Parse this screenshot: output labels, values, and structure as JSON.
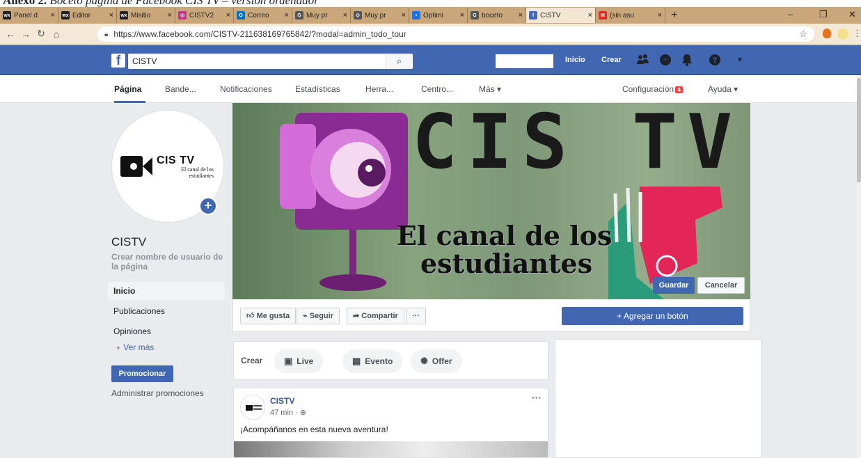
{
  "document": {
    "caption_prefix": "Anexo 2.",
    "caption_text": "Boceto página de Facebook CIS TV – versión ordenador"
  },
  "browser": {
    "tabs": [
      {
        "label": "Panel d",
        "fav": "wx",
        "color": "#222"
      },
      {
        "label": "Editor",
        "fav": "wx",
        "color": "#222"
      },
      {
        "label": "Misitio",
        "fav": "wx",
        "color": "#222"
      },
      {
        "label": "CISTV2",
        "fav": "◎",
        "color": "#c13584"
      },
      {
        "label": "Correo",
        "fav": "O",
        "color": "#0072c6"
      },
      {
        "label": "Muy pr",
        "fav": "G",
        "color": "#555"
      },
      {
        "label": "Muy pr",
        "fav": "⊙",
        "color": "#555"
      },
      {
        "label": "Optimi",
        "fav": "▪",
        "color": "#1a73e8"
      },
      {
        "label": "boceto",
        "fav": "G",
        "color": "#555"
      },
      {
        "label": "CISTV",
        "fav": "f",
        "color": "#4267b2"
      },
      {
        "label": "(sin asu",
        "fav": "M",
        "color": "#d93025"
      }
    ],
    "new_tab": "+",
    "url": "https://www.facebook.com/CISTV-211638169765842/?modal=admin_todo_tour"
  },
  "fb": {
    "search_value": "CISTV",
    "nav_home": "Inicio",
    "nav_create": "Crear"
  },
  "pagenav": {
    "items": [
      "Página",
      "Bande...",
      "Notificaciones",
      "Estadísticas",
      "Herra...",
      "Centro...",
      "Más ▾"
    ],
    "settings": "Configuración",
    "settings_badge": "4",
    "help": "Ayuda ▾"
  },
  "profile": {
    "logo_title": "CIS TV",
    "logo_sub_1": "El canal de los",
    "logo_sub_2": "estudiantes",
    "name": "CISTV",
    "username_link": "Crear nombre de usuario de la página"
  },
  "sidebar": {
    "items": [
      "Inicio",
      "Publicaciones",
      "Opiniones"
    ],
    "more": "Ver más",
    "promote": "Promocionar",
    "manage_promotions": "Administrar promociones"
  },
  "cover": {
    "title": "CIS TV",
    "subtitle_1": "El canal de los",
    "subtitle_2": "estudiantes",
    "save": "Guardar",
    "cancel": "Cancelar"
  },
  "actions": {
    "like": "Me gusta",
    "follow": "Seguir",
    "share": "Compartir",
    "more": "···",
    "add_button": "+ Agregar un botón"
  },
  "create": {
    "label": "Crear",
    "live": "Live",
    "event": "Evento",
    "offer": "Offer"
  },
  "post": {
    "author": "CISTV",
    "time": "47 min · ",
    "text": "¡Acompáñanos en esta nueva aventura!",
    "more": "···"
  }
}
